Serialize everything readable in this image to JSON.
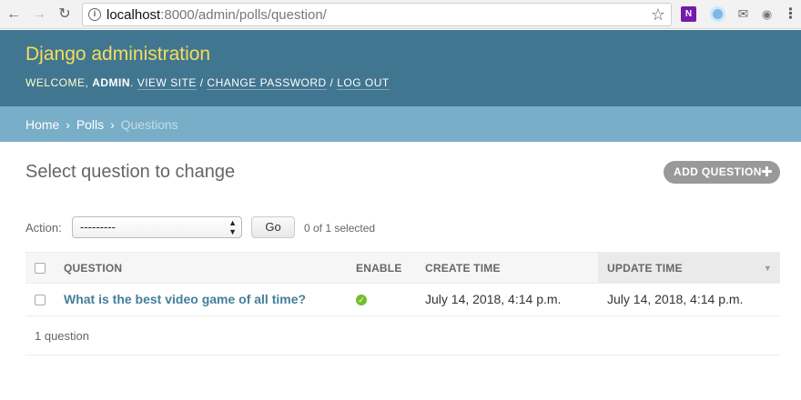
{
  "browser": {
    "url_host": "localhost",
    "url_path": ":8000/admin/polls/question/",
    "extensions": [
      "onenote-icon",
      "circle-extension-icon",
      "mail-icon",
      "camera-icon"
    ],
    "onenote_label": "N"
  },
  "header": {
    "branding": "Django administration",
    "welcome": "WELCOME,",
    "username": "ADMIN",
    "view_site": "VIEW SITE",
    "change_password": "CHANGE PASSWORD",
    "log_out": "LOG OUT",
    "separator": "/"
  },
  "breadcrumbs": {
    "home": "Home",
    "app": "Polls",
    "current": "Questions",
    "separator": "›"
  },
  "main": {
    "title": "Select question to change",
    "add_button": "ADD QUESTION"
  },
  "actions": {
    "label": "Action:",
    "select_value": "---------",
    "go": "Go",
    "selected_count": "0 of 1 selected"
  },
  "table": {
    "columns": [
      "QUESTION",
      "ENABLE",
      "CREATE TIME",
      "UPDATE TIME"
    ],
    "sorted_column": "UPDATE TIME",
    "rows": [
      {
        "question": "What is the best video game of all time?",
        "enable": true,
        "create_time": "July 14, 2018, 4:14 p.m.",
        "update_time": "July 14, 2018, 4:14 p.m."
      }
    ],
    "paginator": "1 question"
  },
  "colors": {
    "header_bg": "#417690",
    "branding": "#f5dd5d",
    "breadcrumbs_bg": "#79aec8",
    "link": "#447e9b",
    "yes_icon": "#70bf2b"
  }
}
